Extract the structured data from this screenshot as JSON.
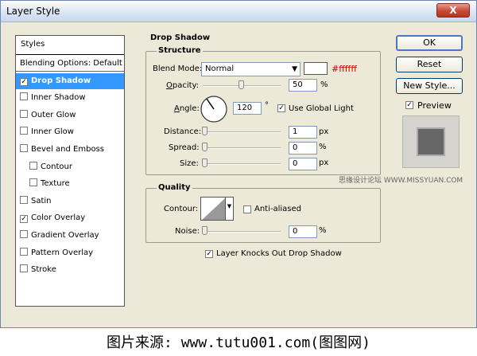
{
  "window": {
    "title": "Layer Style",
    "close_glyph": "X"
  },
  "styles": {
    "header": "Styles",
    "items": [
      {
        "label": "Blending Options: Default",
        "checkbox": false,
        "checked": false,
        "indent": false
      },
      {
        "label": "Drop Shadow",
        "checkbox": true,
        "checked": true,
        "selected": true,
        "indent": false
      },
      {
        "label": "Inner Shadow",
        "checkbox": true,
        "checked": false,
        "indent": false
      },
      {
        "label": "Outer Glow",
        "checkbox": true,
        "checked": false,
        "indent": false
      },
      {
        "label": "Inner Glow",
        "checkbox": true,
        "checked": false,
        "indent": false
      },
      {
        "label": "Bevel and Emboss",
        "checkbox": true,
        "checked": false,
        "indent": false
      },
      {
        "label": "Contour",
        "checkbox": true,
        "checked": false,
        "indent": true
      },
      {
        "label": "Texture",
        "checkbox": true,
        "checked": false,
        "indent": true
      },
      {
        "label": "Satin",
        "checkbox": true,
        "checked": false,
        "indent": false
      },
      {
        "label": "Color Overlay",
        "checkbox": true,
        "checked": true,
        "indent": false
      },
      {
        "label": "Gradient Overlay",
        "checkbox": true,
        "checked": false,
        "indent": false
      },
      {
        "label": "Pattern Overlay",
        "checkbox": true,
        "checked": false,
        "indent": false
      },
      {
        "label": "Stroke",
        "checkbox": true,
        "checked": false,
        "indent": false
      }
    ]
  },
  "drop_shadow": {
    "title": "Drop Shadow",
    "structure": {
      "title": "Structure",
      "blend_mode_label": "Blend Mode:",
      "blend_mode_value": "Normal",
      "color_hex": "#ffffff",
      "opacity_label": "Opacity:",
      "opacity_value": "50",
      "opacity_unit": "%",
      "angle_label": "Angle:",
      "angle_value": "120",
      "angle_unit": "°",
      "use_global_light_label": "Use Global Light",
      "distance_label": "Distance:",
      "distance_value": "1",
      "distance_unit": "px",
      "spread_label": "Spread:",
      "spread_value": "0",
      "spread_unit": "%",
      "size_label": "Size:",
      "size_value": "0",
      "size_unit": "px"
    },
    "quality": {
      "title": "Quality",
      "contour_label": "Contour:",
      "anti_aliased_label": "Anti-aliased",
      "noise_label": "Noise:",
      "noise_value": "0",
      "noise_unit": "%"
    },
    "knockout_label": "Layer Knocks Out Drop Shadow"
  },
  "buttons": {
    "ok": "OK",
    "reset": "Reset",
    "new_style": "New Style...",
    "preview_label": "Preview"
  },
  "watermark": "思缘设计论坛  WWW.MISSYUAN.COM",
  "footer": "图片来源: www.tutu001.com(图图网)"
}
